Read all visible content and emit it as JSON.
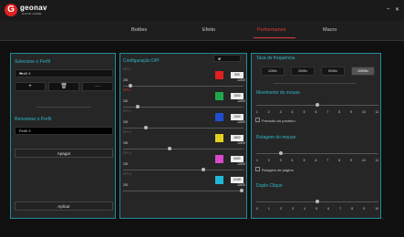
{
  "brand": {
    "name": "geonav",
    "sub": "GOOD GAME",
    "logo": "G"
  },
  "window": {
    "minimize": "–",
    "close": "✕"
  },
  "tabs": [
    {
      "label": "Botões",
      "active": false
    },
    {
      "label": "Efeito",
      "active": false
    },
    {
      "label": "Performance",
      "active": true
    },
    {
      "label": "Macro",
      "active": false
    }
  ],
  "left": {
    "select_title": "Selecione o Perfil",
    "profile": "Perfil 5",
    "add": "+",
    "delete": "🗑",
    "more": "···",
    "rename_title": "Renomear o Perfil",
    "rename_value": "Perfil 3",
    "erase": "Apagar",
    "apply": "Aplicar"
  },
  "dpi": {
    "title": "Configuração DPI",
    "count": "6",
    "rows": [
      {
        "label": "DPI 1",
        "min": "200",
        "max": "12400",
        "value": "800",
        "color": "#e02020",
        "label_color": "#666",
        "level": 0.05
      },
      {
        "label": "DPI 2",
        "min": "200",
        "max": "12400",
        "value": "1600",
        "color": "#1fa84a",
        "label_color": "#e23b3b",
        "level": 0.11
      },
      {
        "label": "DPI 3",
        "min": "200",
        "max": "12400",
        "value": "2400",
        "color": "#1f4fd1",
        "label_color": "#666",
        "level": 0.18
      },
      {
        "label": "DPI 4",
        "min": "200",
        "max": "12400",
        "value": "4800",
        "color": "#e3d11f",
        "label_color": "#666",
        "level": 0.38
      },
      {
        "label": "DPI 5",
        "min": "200",
        "max": "12400",
        "value": "8400",
        "color": "#d84ac9",
        "label_color": "#666",
        "level": 0.67
      },
      {
        "label": "DPI 6",
        "min": "200",
        "max": "12400",
        "value": "12400",
        "color": "#1fb8d8",
        "label_color": "#666",
        "level": 1.0
      }
    ]
  },
  "right": {
    "rate_title": "Taxa de frequência",
    "rates": [
      {
        "label": "125Hz",
        "active": false
      },
      {
        "label": "250Hz",
        "active": false
      },
      {
        "label": "500Hz",
        "active": false
      },
      {
        "label": "1000Hz",
        "active": true
      }
    ],
    "move_title": "Movimento do mouse",
    "move_ticks": [
      "1",
      "2",
      "3",
      "4",
      "5",
      "6",
      "7",
      "8",
      "9",
      "10",
      "11"
    ],
    "move_level": 6,
    "precision_label": "Precisão do ponteiro",
    "scroll_title": "Rolagem do mouse",
    "scroll_ticks": [
      "1",
      "2",
      "3",
      "4",
      "5",
      "6",
      "7",
      "8",
      "9",
      "10",
      "11"
    ],
    "scroll_level": 3,
    "page_scroll_label": "Rolagem de página",
    "dbl_title": "Duplo Clique",
    "dbl_ticks": [
      "0",
      "1",
      "2",
      "3",
      "4",
      "5",
      "6",
      "7",
      "8",
      "9",
      "10"
    ],
    "dbl_level": 5
  },
  "colors": {
    "accent_cyan": "#2fb7c8",
    "accent_red": "#e23b3b"
  }
}
